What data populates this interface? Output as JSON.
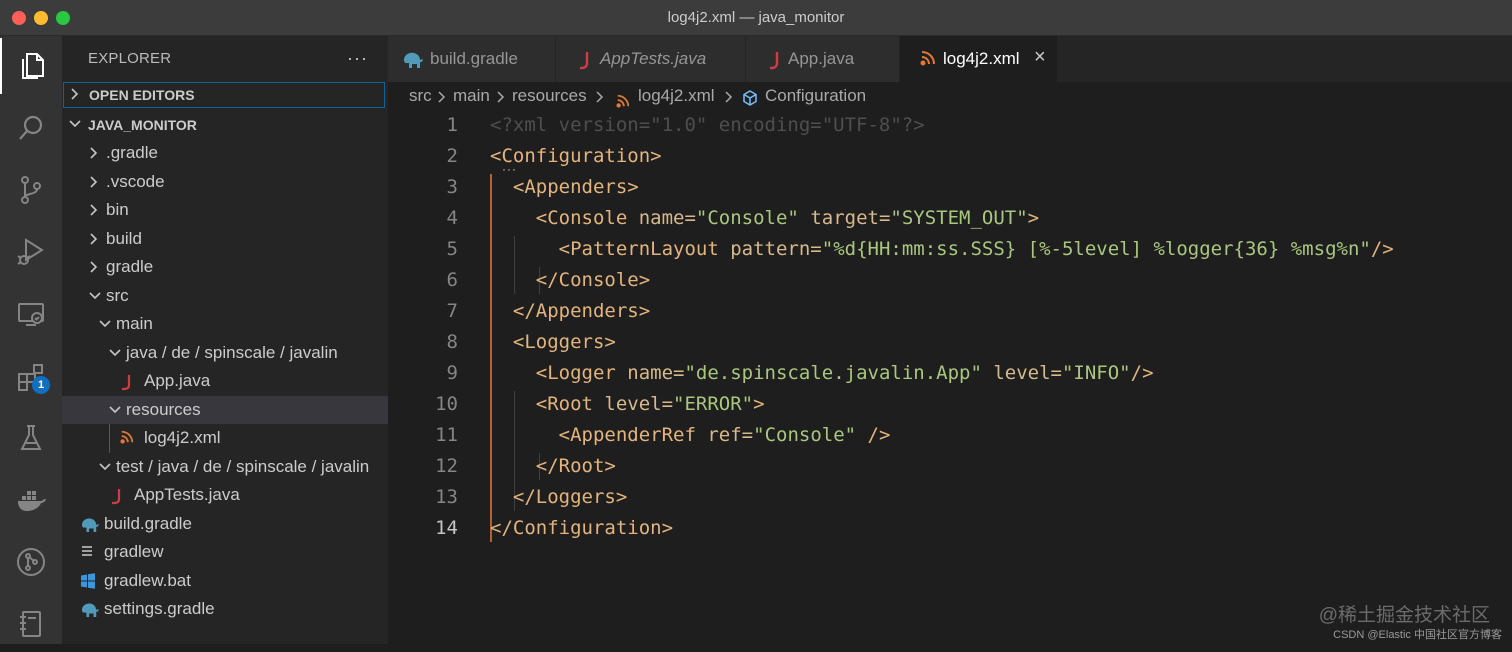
{
  "window": {
    "title": "log4j2.xml — java_monitor"
  },
  "activity_bar": {
    "items": [
      {
        "icon": "explorer-icon",
        "active": true
      },
      {
        "icon": "search-icon"
      },
      {
        "icon": "source-control-icon"
      },
      {
        "icon": "run-debug-icon"
      },
      {
        "icon": "remote-explorer-icon"
      },
      {
        "icon": "extensions-icon",
        "badge": "1"
      },
      {
        "icon": "testing-icon"
      },
      {
        "icon": "docker-icon"
      },
      {
        "icon": "git-graph-icon"
      },
      {
        "icon": "notebook-icon"
      }
    ]
  },
  "sidebar": {
    "header": "EXPLORER",
    "more": "···",
    "open_editors": "OPEN EDITORS",
    "project": "JAVA_MONITOR",
    "tree": [
      {
        "label": ".gradle",
        "type": "folder",
        "expanded": false
      },
      {
        "label": ".vscode",
        "type": "folder",
        "expanded": false
      },
      {
        "label": "bin",
        "type": "folder",
        "expanded": false
      },
      {
        "label": "build",
        "type": "folder",
        "expanded": false
      },
      {
        "label": "gradle",
        "type": "folder",
        "expanded": false
      },
      {
        "label": "src",
        "type": "folder",
        "expanded": true
      },
      {
        "label": "main",
        "type": "folder",
        "expanded": true
      },
      {
        "label": "java / de / spinscale / javalin",
        "type": "folder",
        "expanded": true
      },
      {
        "label": "App.java",
        "type": "java"
      },
      {
        "label": "resources",
        "type": "folder",
        "expanded": true,
        "selected": true
      },
      {
        "label": "log4j2.xml",
        "type": "xml"
      },
      {
        "label": "test / java / de / spinscale / javalin",
        "type": "folder",
        "expanded": true
      },
      {
        "label": "AppTests.java",
        "type": "java"
      },
      {
        "label": "build.gradle",
        "type": "gradle"
      },
      {
        "label": "gradlew",
        "type": "text"
      },
      {
        "label": "gradlew.bat",
        "type": "windows"
      },
      {
        "label": "settings.gradle",
        "type": "gradle"
      }
    ]
  },
  "tabs": [
    {
      "label": "build.gradle",
      "icon": "gradle-elephant-icon"
    },
    {
      "label": "AppTests.java",
      "icon": "java-icon",
      "italic": true
    },
    {
      "label": "App.java",
      "icon": "java-icon"
    },
    {
      "label": "log4j2.xml",
      "icon": "xml-feed-icon",
      "active": true,
      "close": "×"
    }
  ],
  "breadcrumb": [
    "src",
    "main",
    "resources",
    "log4j2.xml",
    "Configuration"
  ],
  "editor": {
    "current_line": 14,
    "line_numbers": [
      "1",
      "2",
      "3",
      "4",
      "5",
      "6",
      "7",
      "8",
      "9",
      "10",
      "11",
      "12",
      "13",
      "14"
    ],
    "lines": [
      [
        [
          "decl",
          "<?xml version=\"1.0\" encoding=\"UTF-8\"?>"
        ]
      ],
      [
        [
          "tag",
          "<Configuration>"
        ]
      ],
      [
        [
          "ws",
          "  "
        ],
        [
          "tag",
          "<Appenders>"
        ]
      ],
      [
        [
          "ws",
          "    "
        ],
        [
          "tag",
          "<Console "
        ],
        [
          "attr",
          "name="
        ],
        [
          "val",
          "\"Console\""
        ],
        [
          "attr",
          " target="
        ],
        [
          "val",
          "\"SYSTEM_OUT\""
        ],
        [
          "tag",
          ">"
        ]
      ],
      [
        [
          "ws",
          "      "
        ],
        [
          "tag",
          "<PatternLayout "
        ],
        [
          "attr",
          "pattern="
        ],
        [
          "val",
          "\"%d{HH:mm:ss.SSS} [%-5level] %logger{36} %msg%n\""
        ],
        [
          "tag",
          "/>"
        ]
      ],
      [
        [
          "ws",
          "    "
        ],
        [
          "tag",
          "</Console>"
        ]
      ],
      [
        [
          "ws",
          "  "
        ],
        [
          "tag",
          "</Appenders>"
        ]
      ],
      [
        [
          "ws",
          "  "
        ],
        [
          "tag",
          "<Loggers>"
        ]
      ],
      [
        [
          "ws",
          "    "
        ],
        [
          "tag",
          "<Logger "
        ],
        [
          "attr",
          "name="
        ],
        [
          "val",
          "\"de.spinscale.javalin.App\""
        ],
        [
          "attr",
          " level="
        ],
        [
          "val",
          "\"INFO\""
        ],
        [
          "tag",
          "/>"
        ]
      ],
      [
        [
          "ws",
          "    "
        ],
        [
          "tag",
          "<Root "
        ],
        [
          "attr",
          "level="
        ],
        [
          "val",
          "\"ERROR\""
        ],
        [
          "tag",
          ">"
        ]
      ],
      [
        [
          "ws",
          "      "
        ],
        [
          "tag",
          "<AppenderRef "
        ],
        [
          "attr",
          "ref="
        ],
        [
          "val",
          "\"Console\""
        ],
        [
          "tag",
          " />"
        ]
      ],
      [
        [
          "ws",
          "    "
        ],
        [
          "tag",
          "</Root>"
        ]
      ],
      [
        [
          "ws",
          "  "
        ],
        [
          "tag",
          "</Loggers>"
        ]
      ],
      [
        [
          "tag",
          "</Configuration>"
        ]
      ]
    ],
    "folded_marker": "···"
  },
  "watermark": {
    "line1": "@稀土掘金技术社区",
    "line2": "CSDN @Elastic 中国社区官方博客"
  },
  "colors": {
    "accent": "#0e639c",
    "tag": "#e3b47e",
    "value": "#a9c77e",
    "java": "#cc3e44",
    "xml": "#e37933",
    "gradle": "#519aba"
  }
}
